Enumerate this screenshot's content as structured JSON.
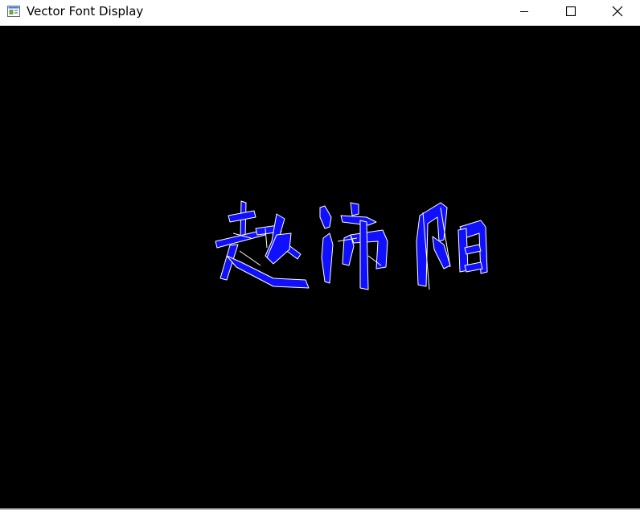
{
  "window": {
    "title": "Vector Font Display",
    "icon": "app-window-icon",
    "controls": {
      "minimize_icon": "minimize-icon",
      "maximize_icon": "maximize-icon",
      "close_icon": "close-icon"
    }
  },
  "canvas": {
    "background_color": "#000000",
    "glyph_fill_color": "#1010ff",
    "glyph_outline_color": "#ffffff",
    "glyphs": [
      {
        "char": "赵"
      },
      {
        "char": "沛"
      },
      {
        "char": "阳"
      }
    ]
  }
}
